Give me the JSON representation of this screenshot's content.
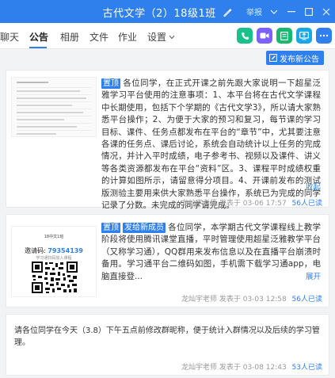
{
  "window": {
    "title": "古代文学（2）18级1班",
    "report_label": "举报",
    "controls": [
      "chevron-down",
      "minimize",
      "maximize",
      "close"
    ]
  },
  "tabs": [
    {
      "label": "聊天"
    },
    {
      "label": "公告",
      "active": true
    },
    {
      "label": "相册"
    },
    {
      "label": "文件"
    },
    {
      "label": "作业"
    },
    {
      "label": "设置"
    }
  ],
  "apps": [
    {
      "name": "call-icon",
      "color": "#1cc08a"
    },
    {
      "name": "video-icon",
      "color": "#7b61ff"
    },
    {
      "name": "doc-icon",
      "color": "#18b86f"
    },
    {
      "name": "screen-share-icon",
      "color": "#19a7e8"
    },
    {
      "name": "more-icon",
      "color": "#2f80ed"
    }
  ],
  "publish_label": "发布新公告",
  "announcements": [
    {
      "tags": [
        "置顶"
      ],
      "text": "各位同学，在正式开课之前先跟大家说明一下超星泛雅学习平台使用的注意事项：1、本平台将在古代文学课程中长期使用，包括下个学期的《古代文学3》，所以请大家熟悉平台操作；2、为便于大家的预习和复习，每节课的学习目标、课件、任务点都发布在平台的“章节”中，尤其要注意各课的任务点、课后讨论，系统会自动统计以上任务的完成情况，并计入平时成绩，电子参考书、视频以及课件、讲义等各类资源都发布在平台“资料”区。3、课程平时成绩权重的计算如图所示，请留意得分项目。4、开课前发布的测试版测验主要用来供大家熟悉平台操作，系统已为完成的同学记录了分数。未完成的同学请完成。",
      "more": "收起",
      "author": "龙灿宇老师",
      "posted": "发表于 03-06 17:57",
      "reads": "56人已读"
    },
    {
      "tags": [
        "置顶",
        "发给新成员"
      ],
      "text": "各位同学，本学期古代文学课程线上教学阶段将使用腾讯课堂直播，平时管理使用超星泛雅教学平台（又称学习通），QQ群用来发布信息以及在直播平台崩溃时备用。学习通平台二维码如图，手机需下载学习通app，电脑直接登...",
      "more": "展开",
      "author": "龙灿宇老师",
      "posted": "发表于 03-03 12:58",
      "reads": "56人已读",
      "poster": {
        "line1": "18中文1班",
        "qq_label": "邀请码:",
        "qq_number": "79354139",
        "line3": "学习通扫码加入课程"
      }
    },
    {
      "text": "请各位同学在今天（3.8）下午五点前修改群昵称，便于统计入群情况以及后续的学习管理。",
      "author": "龙灿宇老师",
      "posted": "发表于 03-08 12:43",
      "reads": "53人已读"
    }
  ]
}
